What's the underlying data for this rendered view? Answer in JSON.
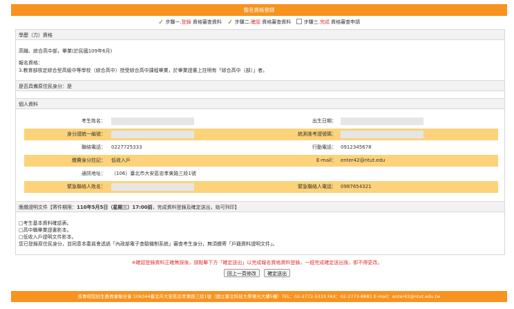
{
  "header": {
    "title": "報名資格登錄"
  },
  "steps": [
    {
      "prefix": "步驟一.",
      "highlight": "登錄",
      "suffix": " 資格審查資料"
    },
    {
      "prefix": "步驟二.",
      "highlight": "確認",
      "suffix": " 資格審查資料"
    },
    {
      "prefix": "步驟三.",
      "highlight": "完成",
      "suffix": " 資格審查申請"
    }
  ],
  "education": {
    "heading": "學歷（力）資格",
    "line1": "高職、綜合高中部，畢業(於民國109年6月)",
    "line2": "報名資格：",
    "line3": "3.教育部核定綜合型高級中等學校（綜合高中）授受綜合高中課程畢業，於畢業證書上註明有「綜合高中（部）」者。"
  },
  "aboriginal": {
    "text": "是否具備原住民身分：是"
  },
  "personal": {
    "heading": "個人資料",
    "name_label": "考生姓名：",
    "birth_label": "出生日期：",
    "id_label": "身分證統一編號：",
    "exam_no_label": "統測准考證號碼：",
    "phone_label": "聯絡電話：",
    "phone": "0227725333",
    "mobile_label": "行動電話：",
    "mobile": "0912345678",
    "fee_label": "繳費身分註記：",
    "fee": "低收入戶",
    "email_label": "E-mail：",
    "email": "enter42@ntut.edu",
    "address_label": "通訊地址：",
    "address": "（106）臺北市大安區忠孝東路三段1號",
    "emergency_name_label": "緊急聯絡人姓名：",
    "emergency_phone_label": "緊急聯絡人電話：",
    "emergency_phone": "0987654321"
  },
  "documents": {
    "heading_prefix": "應繳證明文件【寄件期限：",
    "heading_deadline": "110年5月5日（星期三）17:00前",
    "heading_suffix": "，完成資料登錄及確定送出，始可列印】",
    "items": [
      "□考生基本資料確認表。",
      "□高中職畢業證書影本。",
      "□低收入戶證明文件影本。"
    ],
    "note": "您已登錄原住民身分，並同意本委員會透過「內政部電子查驗機制系統」審查考生身分，無須繳寄「戶籍資料證明文件」。"
  },
  "notice": "※確認登錄資料正確無誤後，請點擊下方「確定送出」以完成報名資格資料登錄，一經完成確定送出後，即不得更改。",
  "buttons": {
    "back": "回上一頁修改",
    "submit": "確定送出"
  },
  "footer": "技專校院招生委員會聯合會 106344臺北市大安區忠孝東路三段1號（國立臺北科技大學億光大樓5樓）TEL：02-2772-5333 FAX：02-2773-8881 E-mail：enter42@ntut.edu.tw"
}
